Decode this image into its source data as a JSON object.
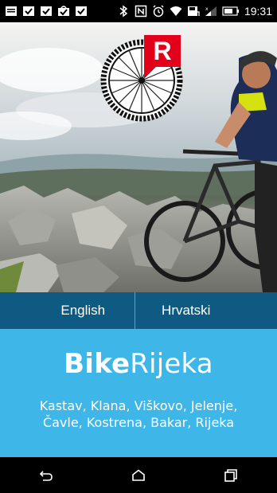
{
  "status_bar": {
    "time": "19:31",
    "icons": [
      "message-icon",
      "check-icon",
      "check-icon",
      "bag-icon",
      "check-icon",
      "bluetooth-icon",
      "nfc-icon",
      "alarm-icon",
      "wifi-icon",
      "save-icon",
      "signal-icon",
      "battery-icon"
    ]
  },
  "hero": {
    "logo_letter": "R"
  },
  "language": {
    "english": "English",
    "croatian": "Hrvatski"
  },
  "brand": {
    "part1": "Bike",
    "part2": "Rijeka"
  },
  "places": {
    "line1": "Kastav, Klana, Viškovo, Jelenje,",
    "line2": "Čavle, Kostrena, Bakar, Rijeka"
  },
  "colors": {
    "language_bar": "#0e5a82",
    "info_panel": "#3fb6e8",
    "logo_red": "#e2001a"
  }
}
